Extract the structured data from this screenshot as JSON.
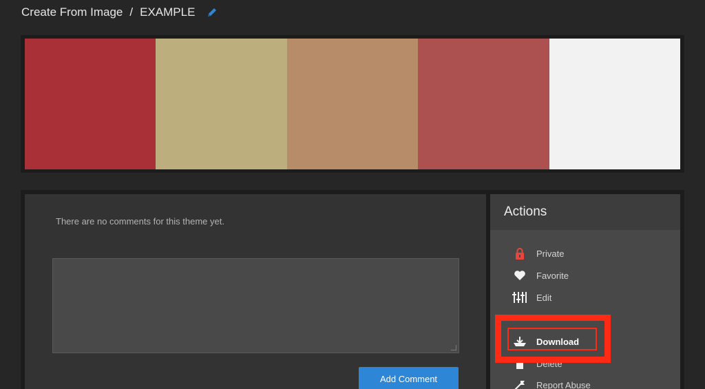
{
  "header": {
    "breadcrumb_root": "Create From Image",
    "separator": "/",
    "theme_name": "EXAMPLE",
    "edit_icon": "pencil-icon"
  },
  "palette": {
    "swatches": [
      {
        "color": "#a83036"
      },
      {
        "color": "#bdae7d"
      },
      {
        "color": "#b78d69"
      },
      {
        "color": "#ad5050"
      },
      {
        "color": "#f2f2f2"
      }
    ]
  },
  "comments": {
    "empty_message": "There are no comments for this theme yet.",
    "textarea_value": "",
    "add_button_label": "Add Comment"
  },
  "actions": {
    "title": "Actions",
    "items": [
      {
        "label": "Private",
        "icon": "lock-icon"
      },
      {
        "label": "Favorite",
        "icon": "heart-icon"
      },
      {
        "label": "Edit",
        "icon": "sliders-icon"
      },
      {
        "label": "Download",
        "icon": "download-icon"
      },
      {
        "label": "Delete",
        "icon": "trash-icon"
      },
      {
        "label": "Report Abuse",
        "icon": "flag-icon"
      }
    ]
  },
  "colors": {
    "accent_blue": "#2d86d6",
    "highlight_red": "#ff2a14",
    "lock_red": "#e8453c"
  }
}
